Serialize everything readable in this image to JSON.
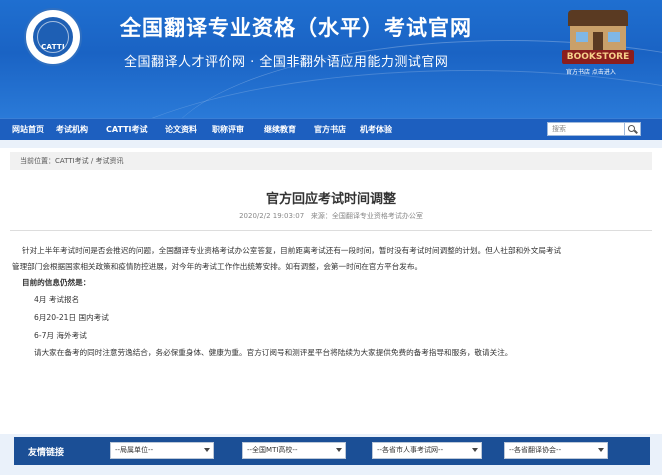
{
  "header": {
    "logo_text": "CATTI",
    "title": "全国翻译专业资格（水平）考试官网",
    "subtitle": "全国翻译人才评价网 · 全国非翻外语应用能力测试官网",
    "bookstore_sign": "BOOKSTORE",
    "shop_link": "官方书店 点击进入"
  },
  "nav": {
    "items": [
      "网站首页",
      "考试机构",
      "CATTI考试",
      "论文资料",
      "职称评审",
      "继续教育",
      "官方书店",
      "机考体验"
    ],
    "search_placeholder": "搜索"
  },
  "breadcrumb": {
    "prefix": "当前位置：",
    "item1": "CATTI考试",
    "sep": " / ",
    "item2": "考试资讯"
  },
  "article": {
    "title": "官方回应考试时间调整",
    "date": "2020/2/2 19:03:07",
    "source": "来源：全国翻译专业资格考试办公室",
    "p1_line1": "针对上半年考试时间是否会推迟的问题，全国翻译专业资格考试办公室答复，目前距离考试还有一段时间，暂时没有考试时间调整的计划。但人社部和外文局考试",
    "p1_line2": "管理部门会根据国家相关政策和疫情防控进展，对今年的考试工作作出统筹安排。如有调整，会第一时间在官方平台发布。",
    "schedule_heading": "目前的信息仍然是：",
    "schedule_items": [
      "4月 考试报名",
      "6月20-21日 国内考试",
      "6-7月 海外考试"
    ],
    "closing": "请大家在备考的同时注意劳逸结合，务必保重身体、健康为重。官方订阅号和测评星平台将陆续为大家提供免费的备考指导和服务，敬请关注。"
  },
  "footer": {
    "label": "友情链接",
    "dropdowns": [
      "--局属单位--",
      "--全国MTI高校--",
      "--各省市人事考试网--",
      "--各省翻译协会--"
    ]
  }
}
